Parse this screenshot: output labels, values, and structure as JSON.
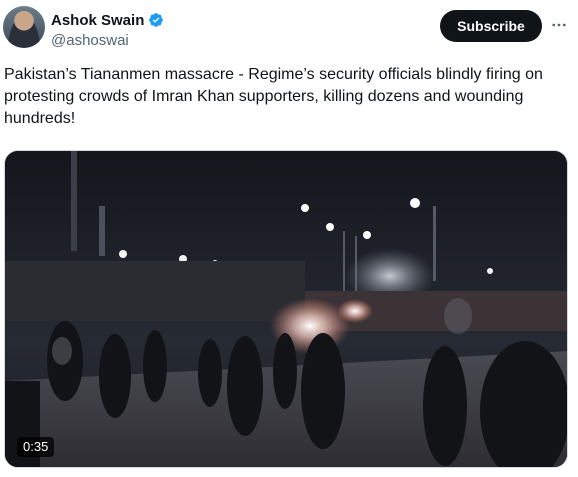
{
  "author": {
    "display_name": "Ashok Swain",
    "handle": "@ashoswai",
    "verified": true
  },
  "actions": {
    "subscribe_label": "Subscribe",
    "more_icon": "more-horizontal-icon"
  },
  "tweet": {
    "text": "Pakistan’s Tiananmen massacre - Regime’s security officials blindly firing on protesting crowds of Imran Khan supporters, killing dozens and wounding hundreds!"
  },
  "media": {
    "type": "video",
    "duration": "0:35"
  },
  "colors": {
    "verified_badge": "#1d9bf0",
    "subscribe_bg": "#0f1419",
    "handle_text": "#536471"
  }
}
